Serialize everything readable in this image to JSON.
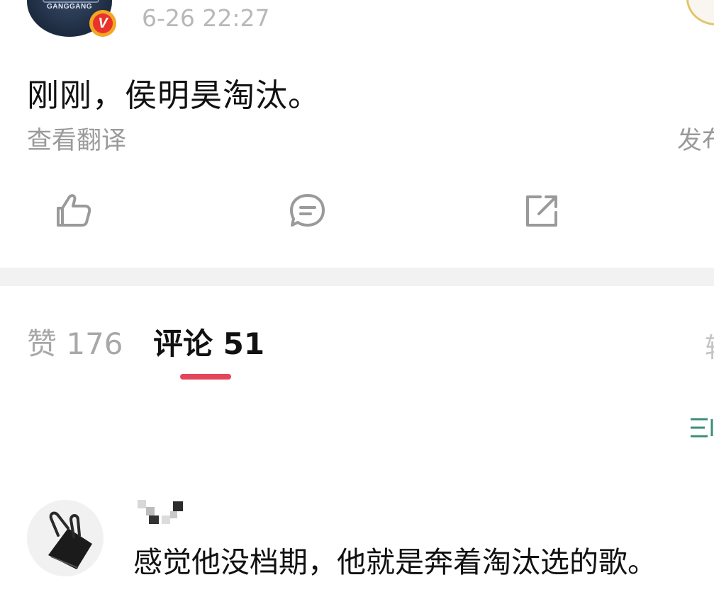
{
  "post": {
    "author_avatar_text": "GANGGANG",
    "verified_mark": "V",
    "timestamp": "6-26 22:27",
    "text": "刚刚，侯明昊淘汰。",
    "translate_label": "查看翻译",
    "publish_partial": "发布"
  },
  "actions": {
    "like_icon": "thumbs-up-icon",
    "comment_icon": "comment-icon",
    "share_icon": "share-icon"
  },
  "tabs": [
    {
      "label": "赞 176",
      "active": false
    },
    {
      "label": "评论 51",
      "active": true
    }
  ],
  "tab_edge_partial": "转",
  "colors": {
    "accent_underline": "#e4455a",
    "verified_badge": "#e8332a",
    "secondary_text": "#9a9a9a"
  },
  "comments": [
    {
      "avatar": "binder-clip-avatar",
      "username": "",
      "text": "感觉他没档期，他就是奔着淘汰选的歌。"
    }
  ]
}
